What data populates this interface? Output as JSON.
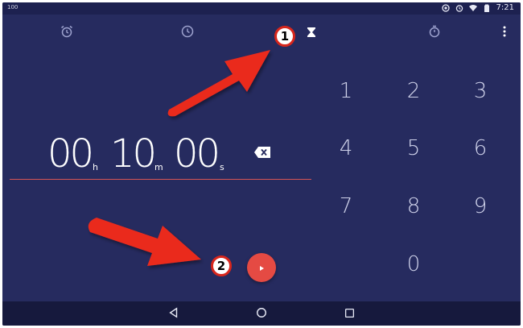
{
  "status_bar": {
    "left_text": "100",
    "time": "7:21"
  },
  "tabs": [
    {
      "name": "alarm",
      "icon": "alarm-clock-icon",
      "active": false
    },
    {
      "name": "clock",
      "icon": "clock-icon",
      "active": false
    },
    {
      "name": "timer",
      "icon": "hourglass-icon",
      "active": true
    },
    {
      "name": "stopwatch",
      "icon": "stopwatch-icon",
      "active": false
    }
  ],
  "timer": {
    "hours": "00",
    "hours_unit": "h",
    "minutes": "10",
    "minutes_unit": "m",
    "seconds": "00",
    "seconds_unit": "s"
  },
  "keypad": [
    "1",
    "2",
    "3",
    "4",
    "5",
    "6",
    "7",
    "8",
    "9",
    "0"
  ],
  "annotations": {
    "badge_1": "1",
    "badge_2": "2"
  },
  "colors": {
    "background": "#262b5f",
    "accent": "#e54a43",
    "annotation_red": "#ea2a1e"
  }
}
